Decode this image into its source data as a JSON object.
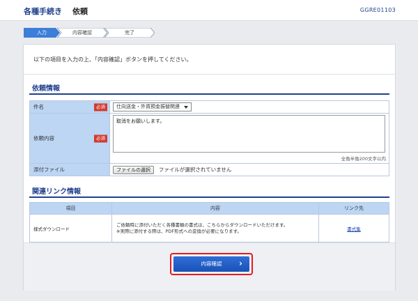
{
  "header": {
    "breadcrumb": [
      "各種手続き",
      "依頼"
    ],
    "screen_id": "GGRE01103"
  },
  "steps": [
    {
      "label": "入力",
      "active": true
    },
    {
      "label": "内容確認",
      "active": false
    },
    {
      "label": "完了",
      "active": false
    }
  ],
  "instruction": "以下の項目を入力の上、「内容確認」ボタンを押してください。",
  "request_section": {
    "title": "依頼情報",
    "required_badge": "必須",
    "subject": {
      "label": "件名",
      "value": "仕向送金・外貨預金振替関連"
    },
    "content": {
      "label": "依頼内容",
      "value": "取消をお願いします。",
      "counter": "全角半角200文字以内"
    },
    "attachment": {
      "label": "添付ファイル",
      "button": "ファイルの選択",
      "status": "ファイルが選択されていません"
    }
  },
  "links_section": {
    "title": "関連リンク情報",
    "columns": [
      "項目",
      "内容",
      "リンク先"
    ],
    "rows": [
      {
        "item": "様式ダウンロード",
        "content_line1": "ご依頼時に添付いただく各種書類の書式は、こちらからダウンロードいただけます。",
        "content_line2": "※実際に添付する際は、PDF形式への変換が必要になります。",
        "link": "書式集"
      }
    ]
  },
  "actions": {
    "confirm_label": "内容確認"
  },
  "colors": {
    "brand": "#1f3f8c",
    "button": "#1a52b8",
    "required": "#d03a2e",
    "highlight": "#e31b23",
    "label_bg": "#bcd6f4"
  }
}
